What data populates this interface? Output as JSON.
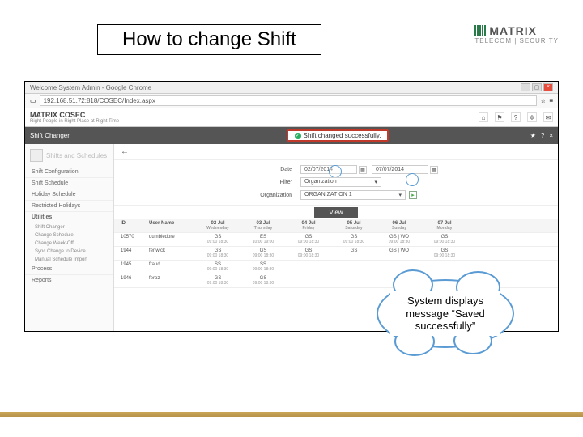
{
  "slide": {
    "title": "How to change Shift"
  },
  "brand": {
    "name": "MATRIX",
    "sub": "TELECOM | SECURITY"
  },
  "chrome": {
    "title": "Welcome System Admin - Google Chrome",
    "url": "192.168.51.72:818/COSEC/Index.aspx"
  },
  "app": {
    "logo_prefix": "MATRIX ",
    "logo": "COSEC",
    "tagline": "Right People in Right Place at Right Time"
  },
  "pagebar": {
    "title": "Shift Changer",
    "success": "Shift changed successfully."
  },
  "sidebar": {
    "header": "Shifts and Schedules",
    "items": [
      "Shift Configuration",
      "Shift Schedule",
      "Holiday Schedule",
      "Restricted Holidays"
    ],
    "utilities_label": "Utilities",
    "utilities": [
      "Shift Changer",
      "Change Schedule",
      "Change Week-Off",
      "Sync Change to Device",
      "Manual Schedule Import"
    ],
    "bottom": [
      "Process",
      "Reports"
    ]
  },
  "filters": {
    "date_label": "Date",
    "date_from": "02/07/2014",
    "date_to": "07/07/2014",
    "filter_label": "Filter",
    "filter_value": "Organization",
    "org_label": "Organization",
    "org_value": "ORGANIZATION 1",
    "view": "View"
  },
  "grid": {
    "headers": {
      "id": "ID",
      "name": "User Name",
      "days": [
        {
          "d": "02 Jul",
          "w": "Wednesday"
        },
        {
          "d": "03 Jul",
          "w": "Thursday"
        },
        {
          "d": "04 Jul",
          "w": "Friday"
        },
        {
          "d": "05 Jul",
          "w": "Saturday"
        },
        {
          "d": "06 Jul",
          "w": "Sunday"
        },
        {
          "d": "07 Jul",
          "w": "Monday"
        }
      ]
    },
    "rows": [
      {
        "id": "10570",
        "name": "dumbledore",
        "cells": [
          {
            "a": "GS",
            "b": "09:00 18:30"
          },
          {
            "a": "ES",
            "b": "10:00 19:00"
          },
          {
            "a": "GS",
            "b": "09:00 18:30"
          },
          {
            "a": "GS",
            "b": "09:00 18:30"
          },
          {
            "a": "GS | WO",
            "b": "09:00 18:30"
          },
          {
            "a": "GS",
            "b": "09:00 18:30"
          }
        ]
      },
      {
        "id": "1944",
        "name": "fenwick",
        "cells": [
          {
            "a": "GS",
            "b": "09:00 18:30"
          },
          {
            "a": "GS",
            "b": "09:00 18:30"
          },
          {
            "a": "GS",
            "b": "09:00 18:30"
          },
          {
            "a": "GS",
            "b": ""
          },
          {
            "a": "GS | WO",
            "b": ""
          },
          {
            "a": "GS",
            "b": "09:00 18:30"
          }
        ]
      },
      {
        "id": "1945",
        "name": "fraud",
        "cells": [
          {
            "a": "SS",
            "b": "09:00 18:30"
          },
          {
            "a": "SS",
            "b": "09:00 18:30"
          },
          {
            "a": "",
            "b": ""
          },
          {
            "a": "",
            "b": ""
          },
          {
            "a": "",
            "b": ""
          },
          {
            "a": "",
            "b": ""
          }
        ]
      },
      {
        "id": "1946",
        "name": "feroz",
        "cells": [
          {
            "a": "GS",
            "b": "09:00 18:30"
          },
          {
            "a": "GS",
            "b": "09:00 18:30"
          },
          {
            "a": "",
            "b": ""
          },
          {
            "a": "",
            "b": ""
          },
          {
            "a": "",
            "b": ""
          },
          {
            "a": "",
            "b": ""
          }
        ]
      }
    ]
  },
  "callout": {
    "text": "System displays message “Saved successfully”"
  }
}
